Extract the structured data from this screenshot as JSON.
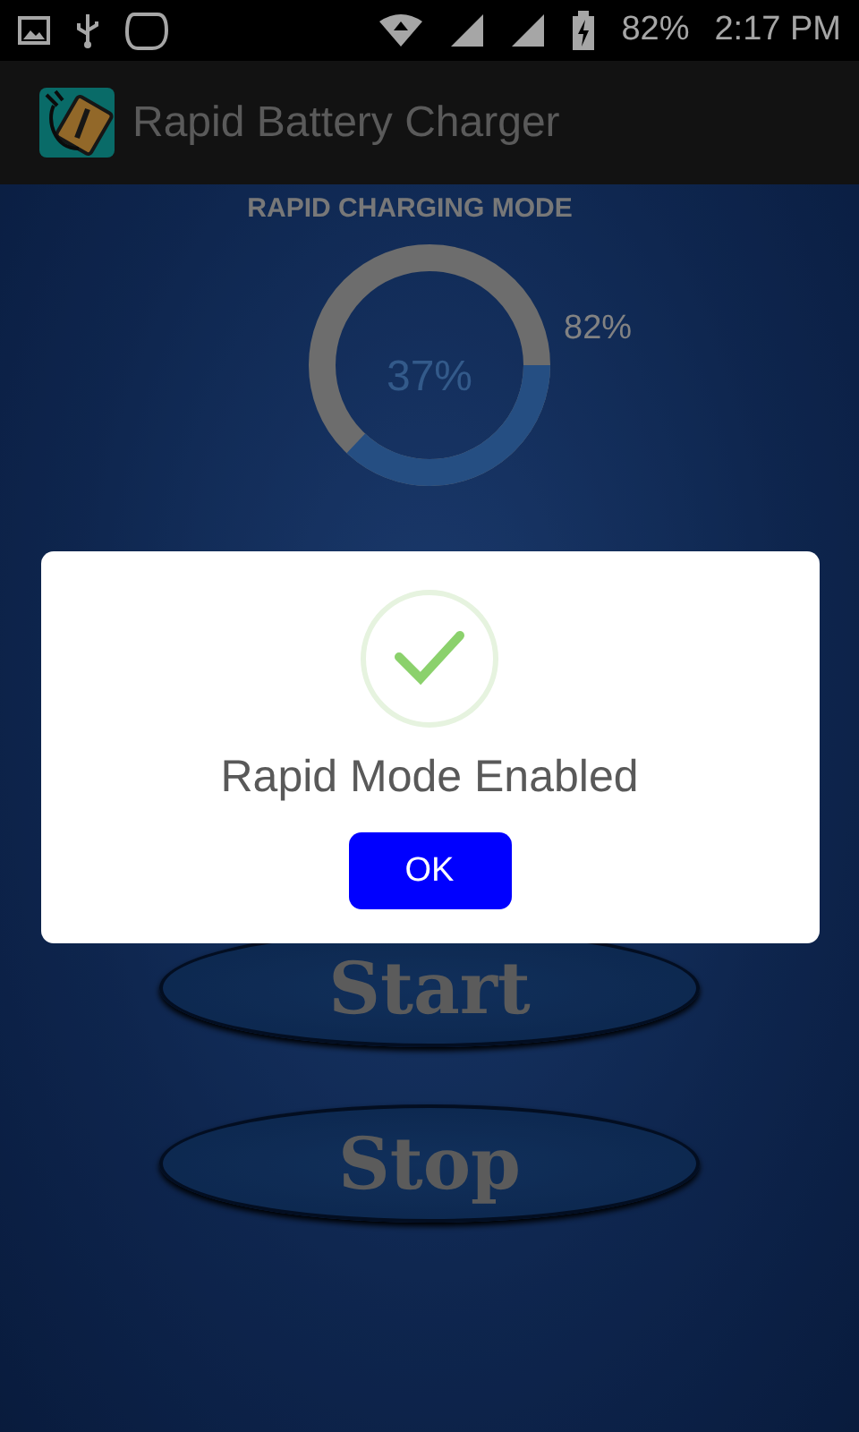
{
  "status_bar": {
    "battery": "82%",
    "time": "2:17 PM"
  },
  "app_bar": {
    "title": "Rapid Battery Charger"
  },
  "gauge": {
    "title": "RAPID CHARGING MODE",
    "level": 0.37,
    "center_label": "37%",
    "side_label": "82%"
  },
  "buttons": [
    {
      "label": "Start"
    },
    {
      "label": "Stop"
    }
  ],
  "dialog": {
    "message": "Rapid Mode Enabled",
    "button": "OK"
  }
}
